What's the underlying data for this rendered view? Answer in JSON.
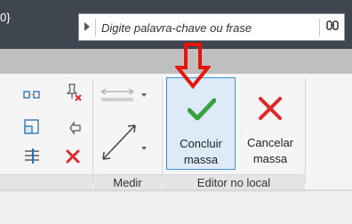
{
  "top_bar": {
    "left_fragment": "0}",
    "search": {
      "placeholder": "Digite palavra-chave ou frase",
      "arrow_icon": "triangle-right-icon",
      "right_icon": "binoculars-icon"
    }
  },
  "ribbon": {
    "panels": [
      {
        "id": "modify-tools",
        "label": ""
      },
      {
        "id": "measure",
        "label": "Medir"
      },
      {
        "id": "in-place-editor",
        "label": "Editor no local"
      }
    ],
    "buttons": {
      "finish_mass": {
        "line1": "Concluir",
        "line2": "massa",
        "icon": "green-check-icon"
      },
      "cancel_mass": {
        "line1": "Cancelar",
        "line2": "massa",
        "icon": "red-x-icon"
      }
    }
  },
  "colors": {
    "topbar": "#3f4650",
    "tabstrip": "#bfbfbf",
    "highlight_border": "#3c8fd6",
    "highlight_bg": "#dcebf7",
    "check_green": "#3aa040",
    "x_red": "#e02828",
    "arrow_red": "#e8140c"
  },
  "annotation": {
    "icon": "red-down-arrow-icon"
  }
}
